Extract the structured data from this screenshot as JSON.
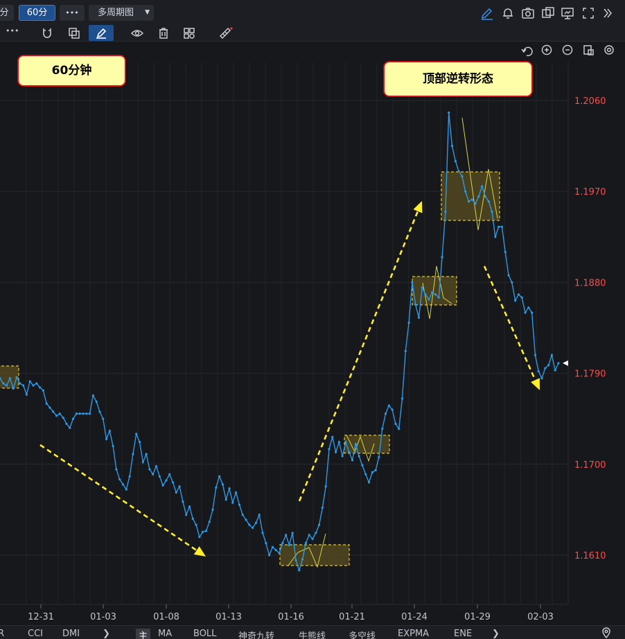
{
  "toolbar": {
    "tab_fen": "分",
    "period": "60分",
    "more": "•••",
    "multi_period": "多周期图",
    "overflow": "•••"
  },
  "annotations": {
    "period_label": "60分钟",
    "pattern_label": "顶部逆转形态"
  },
  "indicators": [
    "R",
    "CCI",
    "DMI",
    "主",
    "MA",
    "BOLL",
    "神奇九转",
    "牛熊线",
    "多空线",
    "EXPMA",
    "ENE"
  ],
  "colors": {
    "background": "#17181c",
    "line": "#2b9be8",
    "arrow": "#ffee2a",
    "box_fill": "#5a4d1f",
    "box_border": "#e6c620",
    "price_label": "#ff4d4d"
  },
  "chart_data": {
    "type": "line",
    "y_ticks": [
      "1.2060",
      "1.1970",
      "1.1880",
      "1.1790",
      "1.1700",
      "1.1610"
    ],
    "x_ticks": [
      "12-31",
      "01-03",
      "01-08",
      "01-13",
      "01-16",
      "01-21",
      "01-24",
      "01-29",
      "02-03"
    ],
    "ylim": [
      1.157,
      1.21
    ],
    "grid": true,
    "series": [
      {
        "values": [
          1.1785,
          1.178,
          1.1778,
          1.1785,
          1.1775,
          1.1786,
          1.178,
          1.1778,
          1.1769,
          1.1782,
          1.1778,
          1.178,
          1.1776,
          1.1773,
          1.176,
          1.1756,
          1.1752,
          1.1748,
          1.175,
          1.1746,
          1.174,
          1.1736,
          1.1745,
          1.175,
          1.175,
          1.175,
          1.175,
          1.175,
          1.1768,
          1.1762,
          1.1752,
          1.1745,
          1.1725,
          1.1733,
          1.1718,
          1.1695,
          1.1685,
          1.168,
          1.1675,
          1.1688,
          1.171,
          1.173,
          1.1722,
          1.1702,
          1.171,
          1.1695,
          1.169,
          1.1698,
          1.1688,
          1.1679,
          1.1684,
          1.169,
          1.1682,
          1.1672,
          1.1678,
          1.1663,
          1.165,
          1.1658,
          1.1646,
          1.164,
          1.1628,
          1.1633,
          1.1634,
          1.1643,
          1.1655,
          1.1677,
          1.1688,
          1.168,
          1.1665,
          1.1676,
          1.1662,
          1.1672,
          1.166,
          1.165,
          1.1645,
          1.164,
          1.1637,
          1.1642,
          1.165,
          1.1632,
          1.1622,
          1.161,
          1.1618,
          1.1615,
          1.1612,
          1.1622,
          1.163,
          1.162,
          1.1632,
          1.1605,
          1.1595,
          1.1606,
          1.1622,
          1.163,
          1.1626,
          1.1632,
          1.164,
          1.1657,
          1.1678,
          1.1715,
          1.1727,
          1.1712,
          1.1722,
          1.1708,
          1.1722,
          1.1712,
          1.1704,
          1.172,
          1.1708,
          1.1699,
          1.169,
          1.1682,
          1.1692,
          1.1694,
          1.1707,
          1.1735,
          1.175,
          1.1758,
          1.1754,
          1.174,
          1.1735,
          1.1765,
          1.1812,
          1.184,
          1.188,
          1.1858,
          1.1845,
          1.1875,
          1.1868,
          1.1863,
          1.187,
          1.1868,
          1.1865,
          1.1905,
          1.195,
          1.2048,
          1.2015,
          1.2,
          1.199,
          1.1985,
          1.197,
          1.196,
          1.1962,
          1.1958,
          1.1965,
          1.1975,
          1.1965,
          1.196,
          1.195,
          1.1925,
          1.1935,
          1.1935,
          1.191,
          1.1887,
          1.188,
          1.1862,
          1.1868,
          1.1865,
          1.185,
          1.1855,
          1.185,
          1.1808,
          1.1792,
          1.1785,
          1.1795,
          1.1798,
          1.1808,
          1.1793,
          1.18
        ]
      }
    ],
    "last_value": 1.18
  }
}
